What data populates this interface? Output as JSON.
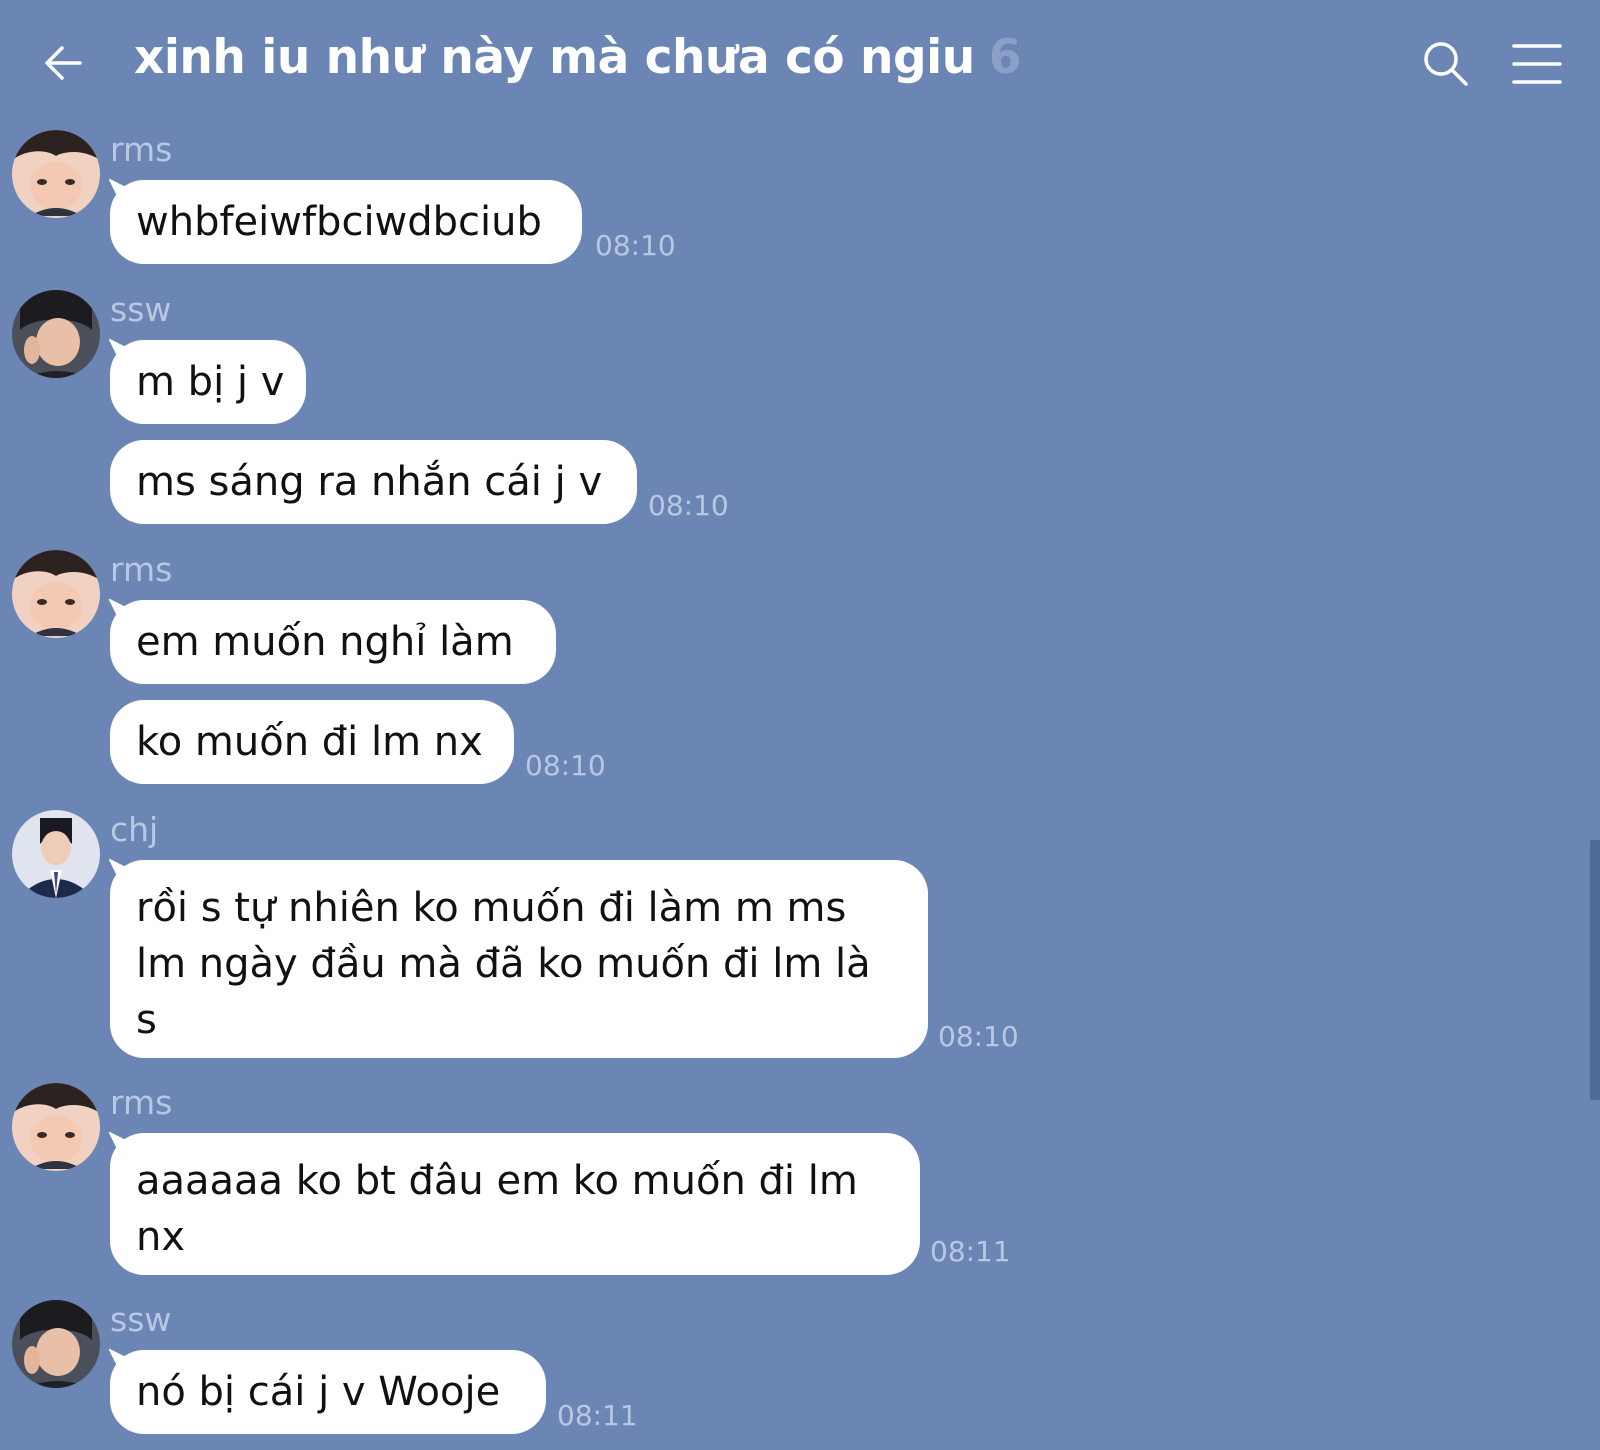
{
  "header": {
    "title": "xinh iu như này mà chưa có ngiu",
    "member_count": "6",
    "back_icon": "arrow-left-icon",
    "search_icon": "search-icon",
    "menu_icon": "hamburger-menu-icon"
  },
  "colors": {
    "background": "#6b86b4",
    "bubble": "#ffffff",
    "meta_text": "#b9c8e2"
  },
  "messages": [
    {
      "sender": "rms",
      "text": "whbfeiwfbciwdbciub",
      "time": "08:10"
    },
    {
      "sender": "ssw",
      "text": "m bị j v"
    },
    {
      "text": "ms sáng ra nhắn cái j v",
      "time": "08:10"
    },
    {
      "sender": "rms",
      "text": "em muốn nghỉ làm"
    },
    {
      "text": "ko muốn đi lm nx",
      "time": "08:10"
    },
    {
      "sender": "chj",
      "lines": [
        "rồi s tự nhiên ko muốn đi làm m ms",
        "lm ngày đầu mà đã ko muốn đi lm là",
        "s"
      ],
      "time": "08:10"
    },
    {
      "sender": "rms",
      "lines": [
        "aaaaaa ko bt đâu em ko muốn đi lm",
        "nx"
      ],
      "time": "08:11"
    },
    {
      "sender": "ssw",
      "text": "nó bị cái j v Wooje",
      "time": "08:11"
    }
  ]
}
